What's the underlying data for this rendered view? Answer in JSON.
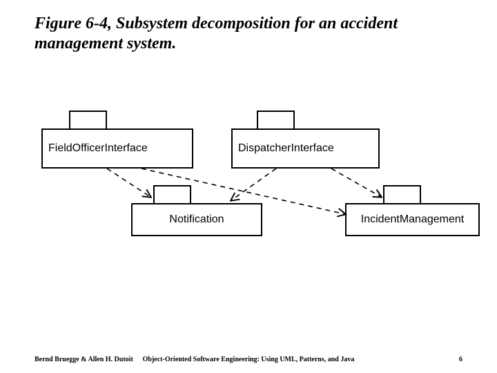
{
  "title": "Figure 6-4, Subsystem decomposition for an accident management system.",
  "packages": {
    "fieldOfficer": "FieldOfficerInterface",
    "dispatcher": "DispatcherInterface",
    "notification": "Notification",
    "incident": "IncidentManagement"
  },
  "footer": {
    "left": "Bernd Bruegge & Allen H. Dutoit",
    "center": "Object-Oriented Software Engineering: Using UML, Patterns, and Java",
    "right": "6"
  },
  "chart_data": {
    "type": "diagram",
    "title": "Figure 6-4, Subsystem decomposition for an accident management system.",
    "nodes": [
      {
        "id": "FieldOfficerInterface",
        "kind": "package"
      },
      {
        "id": "DispatcherInterface",
        "kind": "package"
      },
      {
        "id": "Notification",
        "kind": "package"
      },
      {
        "id": "IncidentManagement",
        "kind": "package"
      }
    ],
    "edges": [
      {
        "from": "FieldOfficerInterface",
        "to": "Notification",
        "style": "dashed-arrow"
      },
      {
        "from": "DispatcherInterface",
        "to": "Notification",
        "style": "dashed-arrow"
      },
      {
        "from": "FieldOfficerInterface",
        "to": "IncidentManagement",
        "style": "dashed-arrow"
      },
      {
        "from": "DispatcherInterface",
        "to": "IncidentManagement",
        "style": "dashed-arrow"
      }
    ]
  }
}
